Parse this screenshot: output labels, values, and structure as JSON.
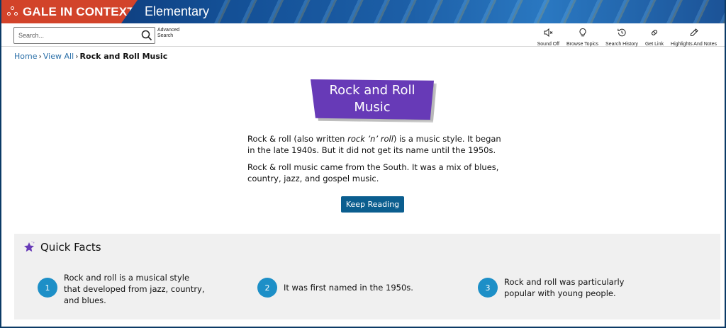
{
  "header": {
    "brand": "GALE IN CONTEXT",
    "edition": "Elementary",
    "brand_color": "#d2432a"
  },
  "toolbar": {
    "search_placeholder": "Search...",
    "advanced_search": "Advanced Search",
    "tools": [
      {
        "label": "Sound Off",
        "icon": "speaker-mute-icon"
      },
      {
        "label": "Browse Topics",
        "icon": "lightbulb-icon"
      },
      {
        "label": "Search History",
        "icon": "history-icon"
      },
      {
        "label": "Get Link",
        "icon": "link-icon"
      },
      {
        "label": "Highlights And Notes",
        "icon": "pencil-icon"
      }
    ]
  },
  "breadcrumb": {
    "home": "Home",
    "view_all": "View All",
    "current": "Rock and Roll Music"
  },
  "article": {
    "title": "Rock and Roll Music",
    "title_color": "#673ab7",
    "para1_a": "Rock & roll (also written ",
    "para1_em": "rock ’n’ roll",
    "para1_b": ") is a music style. It began in the late 1940s. But it did not get its name until the 1950s.",
    "para2": "Rock & roll music came from the South. It was a mix of blues, country, jazz, and gospel music.",
    "keep_reading": "Keep Reading"
  },
  "quick_facts": {
    "title": "Quick Facts",
    "facts": [
      {
        "num": "1",
        "text": "Rock and roll is a musical style that developed from jazz, country, and blues."
      },
      {
        "num": "2",
        "text": "It was first named in the 1950s."
      },
      {
        "num": "3",
        "text": "Rock and roll was particularly popular with young people."
      }
    ]
  }
}
